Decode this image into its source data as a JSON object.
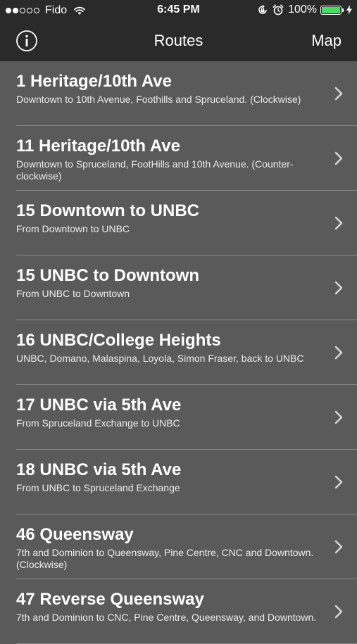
{
  "status_bar": {
    "carrier": "Fido",
    "signal_dots_filled": 2,
    "signal_dots_total": 5,
    "time": "6:45 PM",
    "battery_percent": "100%",
    "battery_color": "#4cd964"
  },
  "nav": {
    "title": "Routes",
    "map_label": "Map",
    "info_icon": "info-circle-icon"
  },
  "routes": [
    {
      "title": "1 Heritage/10th Ave",
      "subtitle": "Downtown to 10th Avenue, Foothills and Spruceland. (Clockwise)"
    },
    {
      "title": "11 Heritage/10th Ave",
      "subtitle": "Downtown to Spruceland, FootHills and 10th Avenue. (Counter-clockwise)"
    },
    {
      "title": "15 Downtown to UNBC",
      "subtitle": "From Downtown to UNBC"
    },
    {
      "title": "15 UNBC to Downtown",
      "subtitle": "From UNBC to Downtown"
    },
    {
      "title": "16 UNBC/College Heights",
      "subtitle": "UNBC, Domano, Malaspina, Loyola, Simon Fraser, back to UNBC"
    },
    {
      "title": "17 UNBC via 5th Ave",
      "subtitle": "From Spruceland Exchange to UNBC"
    },
    {
      "title": "18 UNBC via 5th Ave",
      "subtitle": "From UNBC to Spruceland Exchange"
    },
    {
      "title": "46 Queensway",
      "subtitle": "7th and Dominion to Queensway, Pine Centre, CNC and Downtown. (Clockwise)"
    },
    {
      "title": "47 Reverse Queensway",
      "subtitle": "7th and Dominion to CNC, Pine Centre, Queensway, and Downtown."
    }
  ]
}
